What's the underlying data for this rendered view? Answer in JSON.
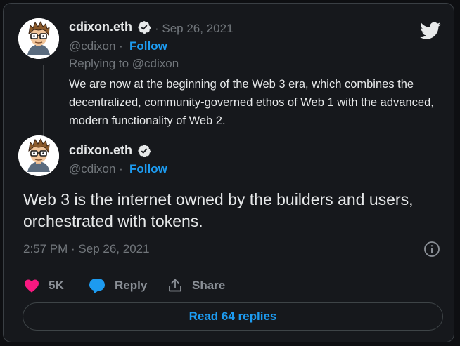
{
  "colors": {
    "background": "#16181c",
    "accent": "#1d9bf0",
    "like": "#f91880",
    "text": "#e7e9ea",
    "muted": "#71767b"
  },
  "icons": {
    "brand": "twitter-bird-icon",
    "verified": "verified-badge-icon",
    "like": "heart-icon",
    "reply": "speech-bubble-icon",
    "share": "share-upload-icon",
    "info": "info-icon"
  },
  "parent_tweet": {
    "display_name": "cdixon.eth",
    "date": "· Sep 26, 2021",
    "handle": "@cdixon ·",
    "follow_label": "Follow",
    "replying_to": "Replying to @cdixon",
    "text": "We are now at the beginning of the Web 3 era, which combines the decentralized, community-governed ethos of Web 1 with the advanced, modern functionality of Web 2."
  },
  "main_tweet": {
    "display_name": "cdixon.eth",
    "handle": "@cdixon ·",
    "follow_label": "Follow",
    "text": "Web 3 is the internet owned by the builders and users, orchestrated with tokens.",
    "timestamp": "2:57 PM · Sep 26, 2021"
  },
  "actions": {
    "like_count": "5K",
    "reply_label": "Reply",
    "share_label": "Share"
  },
  "footer": {
    "read_replies_label": "Read 64 replies"
  }
}
